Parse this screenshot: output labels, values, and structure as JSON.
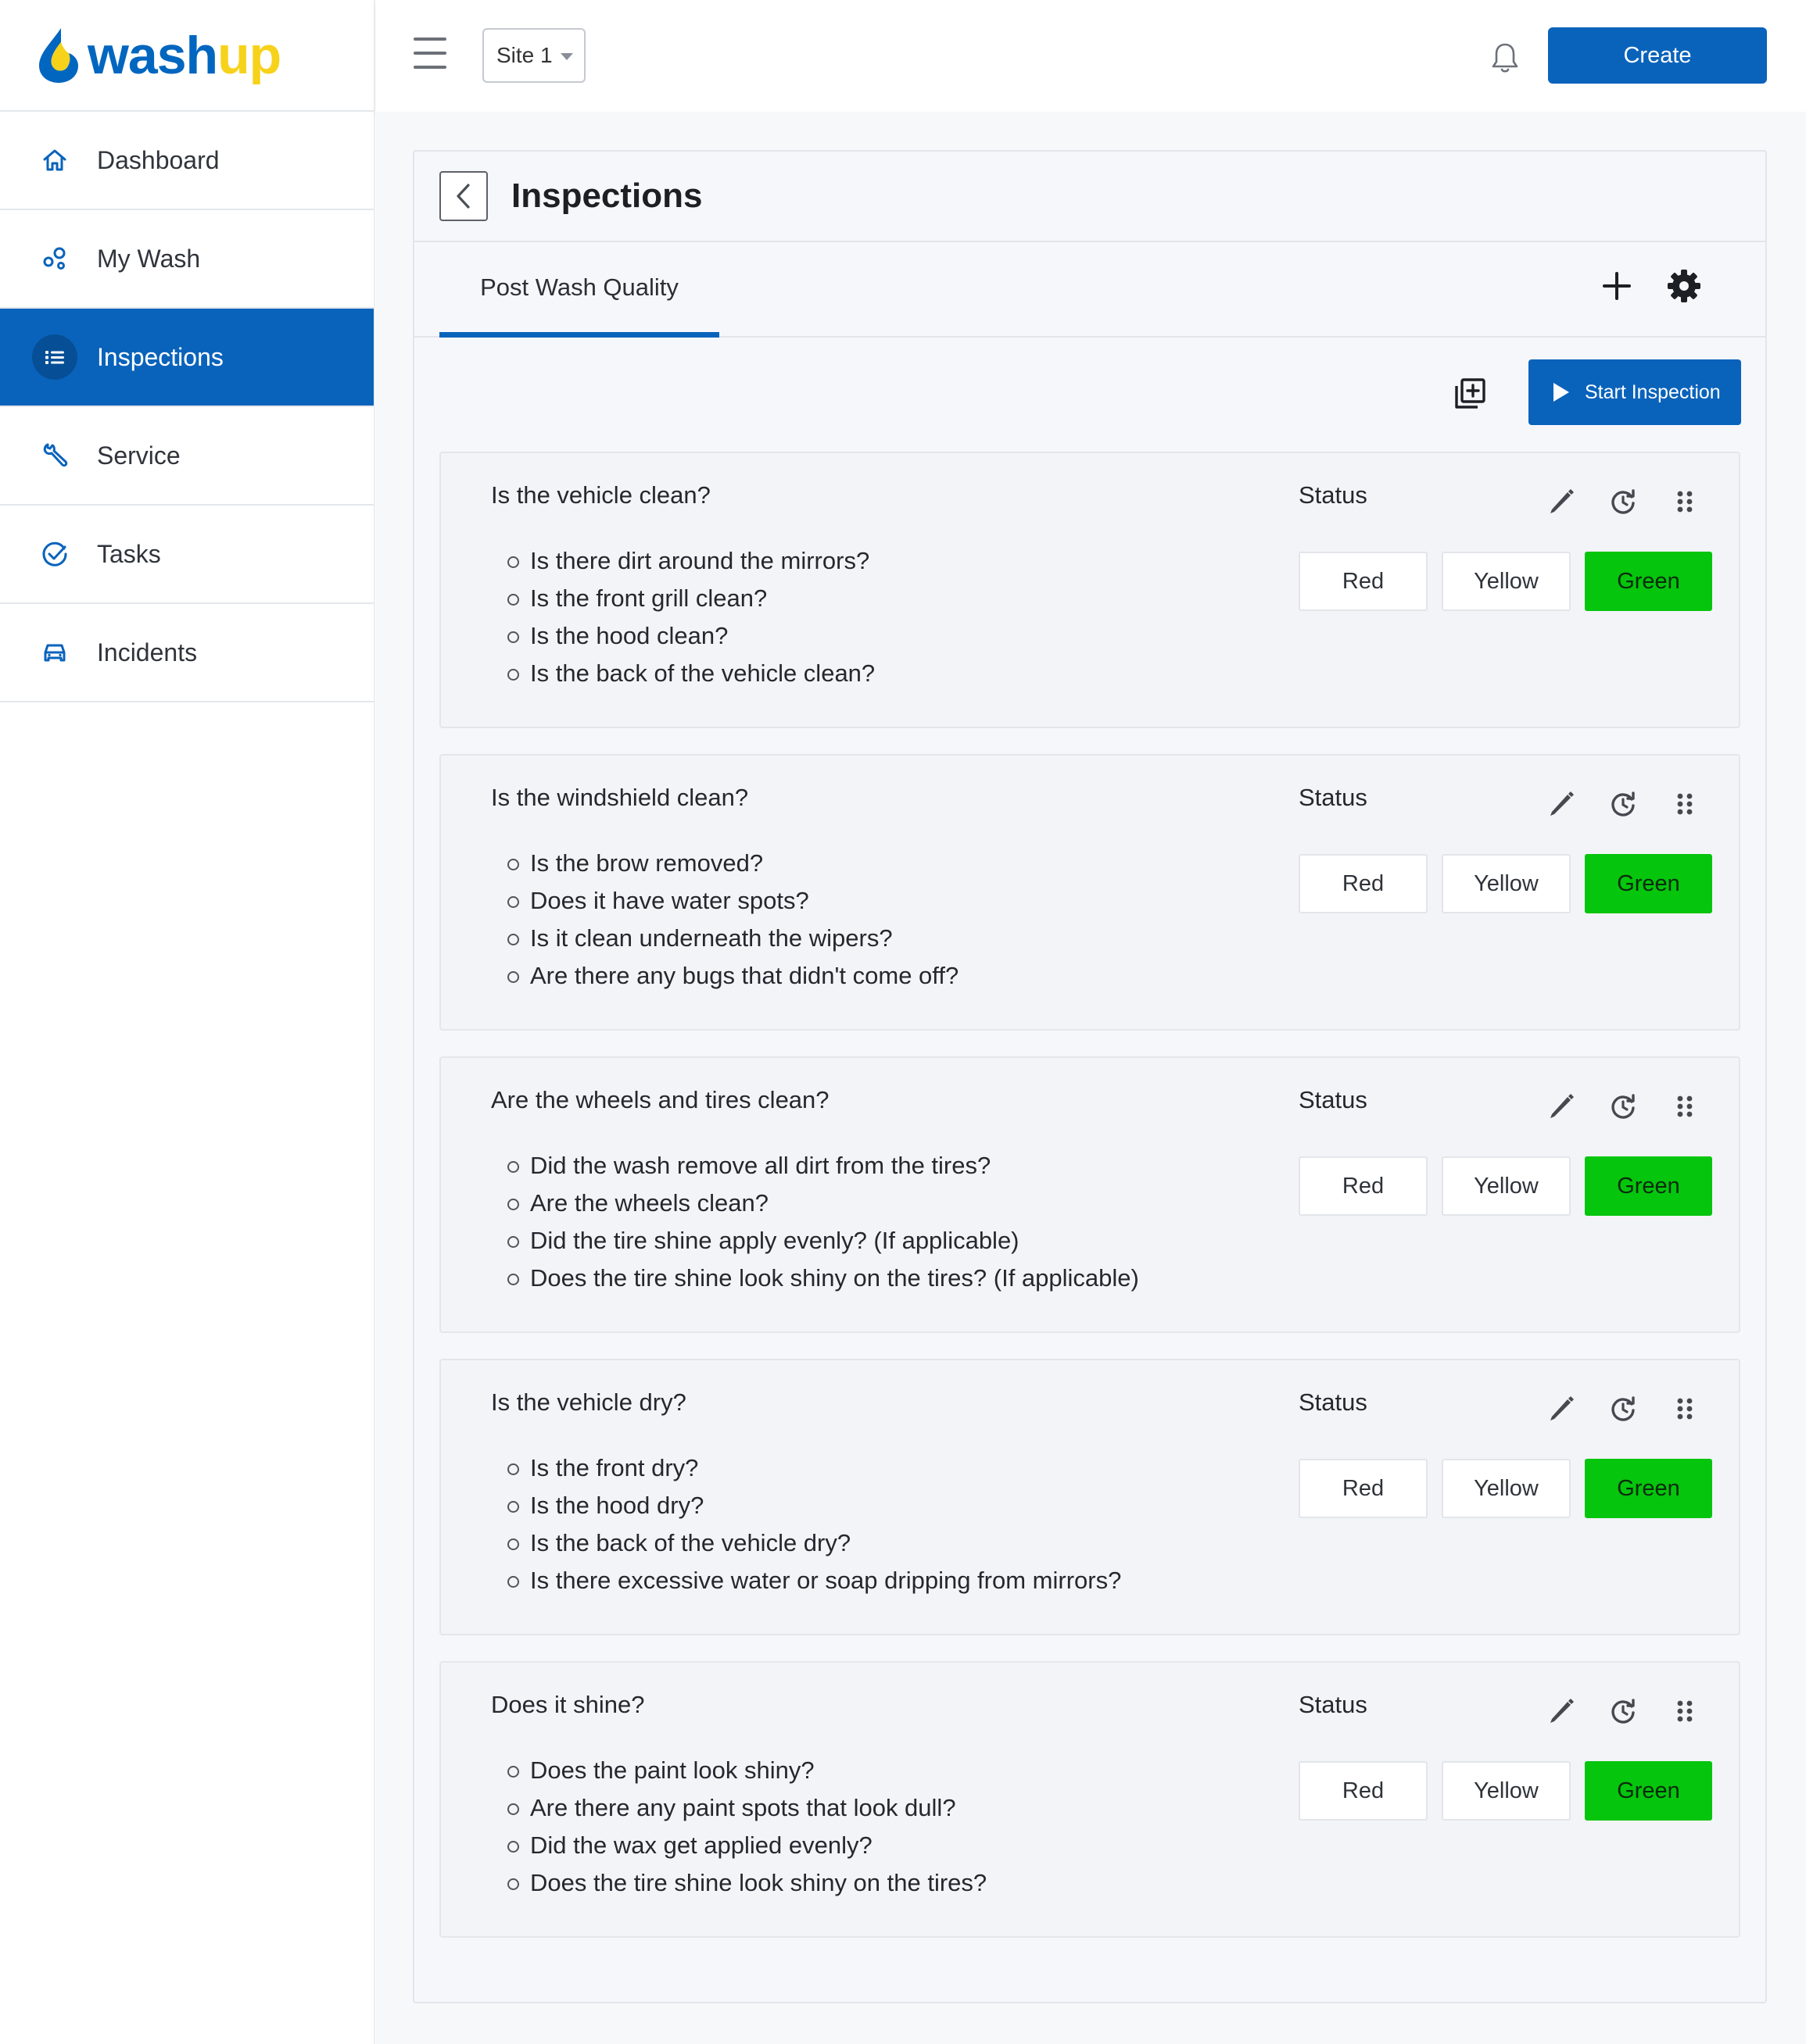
{
  "brand": {
    "wash": "wash",
    "up": "up",
    "colors": {
      "primary": "#0a63bb",
      "accent": "#f7d21b",
      "green": "#05c50d"
    }
  },
  "sidebar": {
    "items": [
      {
        "label": "Dashboard",
        "icon": "home-icon"
      },
      {
        "label": "My Wash",
        "icon": "bubbles-icon"
      },
      {
        "label": "Inspections",
        "icon": "list-icon",
        "active": true
      },
      {
        "label": "Service",
        "icon": "wrench-icon"
      },
      {
        "label": "Tasks",
        "icon": "check-circle-icon"
      },
      {
        "label": "Incidents",
        "icon": "car-icon"
      }
    ]
  },
  "topbar": {
    "site_select": "Site 1",
    "create_label": "Create",
    "icons": [
      "hamburger-icon",
      "bell-icon"
    ]
  },
  "page": {
    "title": "Inspections",
    "tab": "Post Wash Quality",
    "start_label": "Start Inspection"
  },
  "cards": [
    {
      "title": "Is the vehicle clean?",
      "status_label": "Status",
      "items": [
        "Is there dirt around the mirrors?",
        "Is the front grill clean?",
        "Is the hood clean?",
        "Is the back of the vehicle clean?"
      ],
      "buttons": [
        "Red",
        "Yellow",
        "Green"
      ],
      "selected": "Green"
    },
    {
      "title": "Is the windshield clean?",
      "status_label": "Status",
      "items": [
        "Is the brow removed?",
        "Does it have water spots?",
        "Is it clean underneath the wipers?",
        "Are there any bugs that didn't come off?"
      ],
      "buttons": [
        "Red",
        "Yellow",
        "Green"
      ],
      "selected": "Green"
    },
    {
      "title": "Are the wheels and tires clean?",
      "status_label": "Status",
      "items": [
        "Did the wash remove all dirt from the tires?",
        "Are the wheels clean?",
        "Did the tire shine apply evenly? (If applicable)",
        "Does the tire shine look shiny on the tires? (If applicable)"
      ],
      "buttons": [
        "Red",
        "Yellow",
        "Green"
      ],
      "selected": "Green"
    },
    {
      "title": "Is the vehicle dry?",
      "status_label": "Status",
      "items": [
        "Is the front dry?",
        "Is the hood dry?",
        "Is the back of the vehicle dry?",
        "Is there excessive water or soap dripping from mirrors?"
      ],
      "buttons": [
        "Red",
        "Yellow",
        "Green"
      ],
      "selected": "Green"
    },
    {
      "title": "Does it shine?",
      "status_label": "Status",
      "items": [
        "Does the paint look shiny?",
        "Are there any paint spots that look dull?",
        "Did the wax get applied evenly?",
        "Does the tire shine look shiny on the tires?"
      ],
      "buttons": [
        "Red",
        "Yellow",
        "Green"
      ],
      "selected": "Green"
    }
  ]
}
